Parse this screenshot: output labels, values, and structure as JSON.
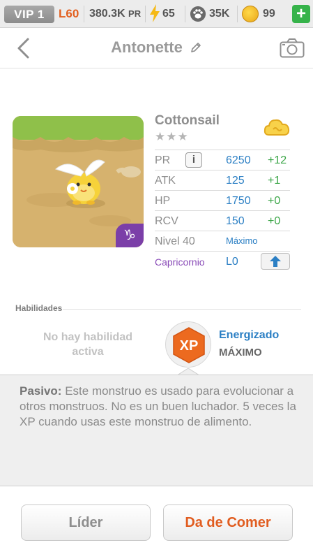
{
  "status_bar": {
    "vip": "VIP 1",
    "level": "L60",
    "power": "380.3K",
    "power_unit": "PR",
    "energy": "65",
    "monsters": "35K",
    "coins": "99",
    "add_label": "+"
  },
  "header": {
    "title": "Antonette"
  },
  "monster": {
    "name": "Cottonsail",
    "stars": "★★★",
    "zodiac_symbol": "♑"
  },
  "stats": [
    {
      "label": "PR",
      "value": "6250",
      "bonus": "+12",
      "info": "i"
    },
    {
      "label": "ATK",
      "value": "125",
      "bonus": "+1"
    },
    {
      "label": "HP",
      "value": "1750",
      "bonus": "+0"
    },
    {
      "label": "RCV",
      "value": "150",
      "bonus": "+0"
    },
    {
      "label": "Nivel 40",
      "value": "Máximo"
    },
    {
      "label": "Capricornio",
      "value": "L0"
    }
  ],
  "abilities": {
    "section_title": "Habilidades",
    "no_active": "No hay habilidad activa",
    "badge_text": "XP",
    "passive_name": "Energizado",
    "passive_level": "MÁXIMO"
  },
  "passive": {
    "label": "Pasivo:",
    "text": " Este monstruo es usado para evolucionar a otros monstruos. No es un buen luchador. 5 veces la XP cuando usas este monstruo de alimento."
  },
  "buttons": {
    "leader": "Líder",
    "feed": "Da de Comer"
  },
  "colors": {
    "accent_orange": "#e15d20",
    "value_blue": "#2b7fc4",
    "bonus_green": "#3aa546",
    "zodiac_purple": "#8a4cb8"
  }
}
